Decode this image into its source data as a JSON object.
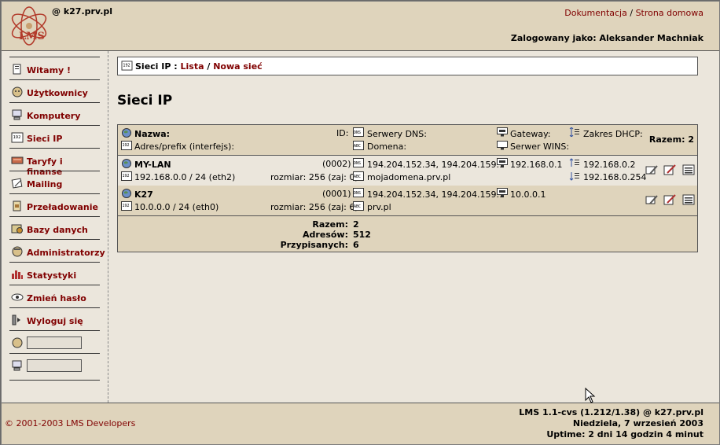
{
  "header": {
    "host": "@ k27.prv.pl",
    "links": {
      "docs": "Dokumentacja",
      "sep": "/",
      "home": "Strona domowa"
    },
    "logged_in": "Zalogowany jako: Aleksander Machniak"
  },
  "sidebar": {
    "items": [
      {
        "label": "Witamy !",
        "icon": "welcome-icon"
      },
      {
        "label": "Użytkownicy",
        "icon": "users-icon"
      },
      {
        "label": "Komputery",
        "icon": "computer-icon"
      },
      {
        "label": "Sieci IP",
        "icon": "network-icon"
      },
      {
        "label": "Taryfy i finanse",
        "icon": "finance-icon"
      },
      {
        "label": "Mailing",
        "icon": "mail-icon"
      },
      {
        "label": "Przeładowanie",
        "icon": "reload-icon"
      },
      {
        "label": "Bazy danych",
        "icon": "database-icon"
      },
      {
        "label": "Administratorzy",
        "icon": "admin-icon"
      },
      {
        "label": "Statystyki",
        "icon": "stats-icon"
      },
      {
        "label": "Zmień hasło",
        "icon": "password-icon"
      },
      {
        "label": "Wyloguj się",
        "icon": "logout-icon"
      }
    ]
  },
  "breadcrumb": {
    "prefix": "Sieci IP : ",
    "list": "Lista",
    "sep": " / ",
    "new": "Nowa sieć"
  },
  "page_title": "Sieci IP",
  "table": {
    "headers": {
      "name": "Nazwa:",
      "address": "Adres/prefix (interfejs):",
      "id": "ID:",
      "dns": "Serwery DNS:",
      "domain": "Domena:",
      "gateway": "Gateway:",
      "wins": "Serwer WINS:",
      "dhcp": "Zakres DHCP:",
      "total": "Razem: 2"
    },
    "rows": [
      {
        "name": "MY-LAN",
        "id": "(0002)",
        "address": "192.168.0.0 / 24 (eth2)",
        "size": "rozmiar: 256 (zaj: 0)",
        "dns": "194.204.152.34, 194.204.159.1",
        "domain": "mojadomena.prv.pl",
        "gateway": "192.168.0.1",
        "dhcp_start": "192.168.0.2",
        "dhcp_end": "192.168.0.254"
      },
      {
        "name": "K27",
        "id": "(0001)",
        "address": "10.0.0.0 / 24 (eth0)",
        "size": "rozmiar: 256 (zaj: 6)",
        "dns": "194.204.152.34, 194.204.159.1",
        "domain": "prv.pl",
        "gateway": "10.0.0.1",
        "dhcp_start": "",
        "dhcp_end": ""
      }
    ],
    "summary": {
      "total_label": "Razem:",
      "total": "2",
      "addresses_label": "Adresów:",
      "addresses": "512",
      "assigned_label": "Przypisanych:",
      "assigned": "6"
    }
  },
  "footer": {
    "copyright": "© 2001-2003 LMS Developers",
    "version": "LMS 1.1-cvs (1.212/1.38) @ k27.prv.pl",
    "date": "Niedziela, 7 wrzesień 2003",
    "uptime": "Uptime: 2 dni 14 godzin 4 minut"
  },
  "colors": {
    "accent": "#800000",
    "panel": "#dfd4bc",
    "background": "#ebe6dc"
  }
}
